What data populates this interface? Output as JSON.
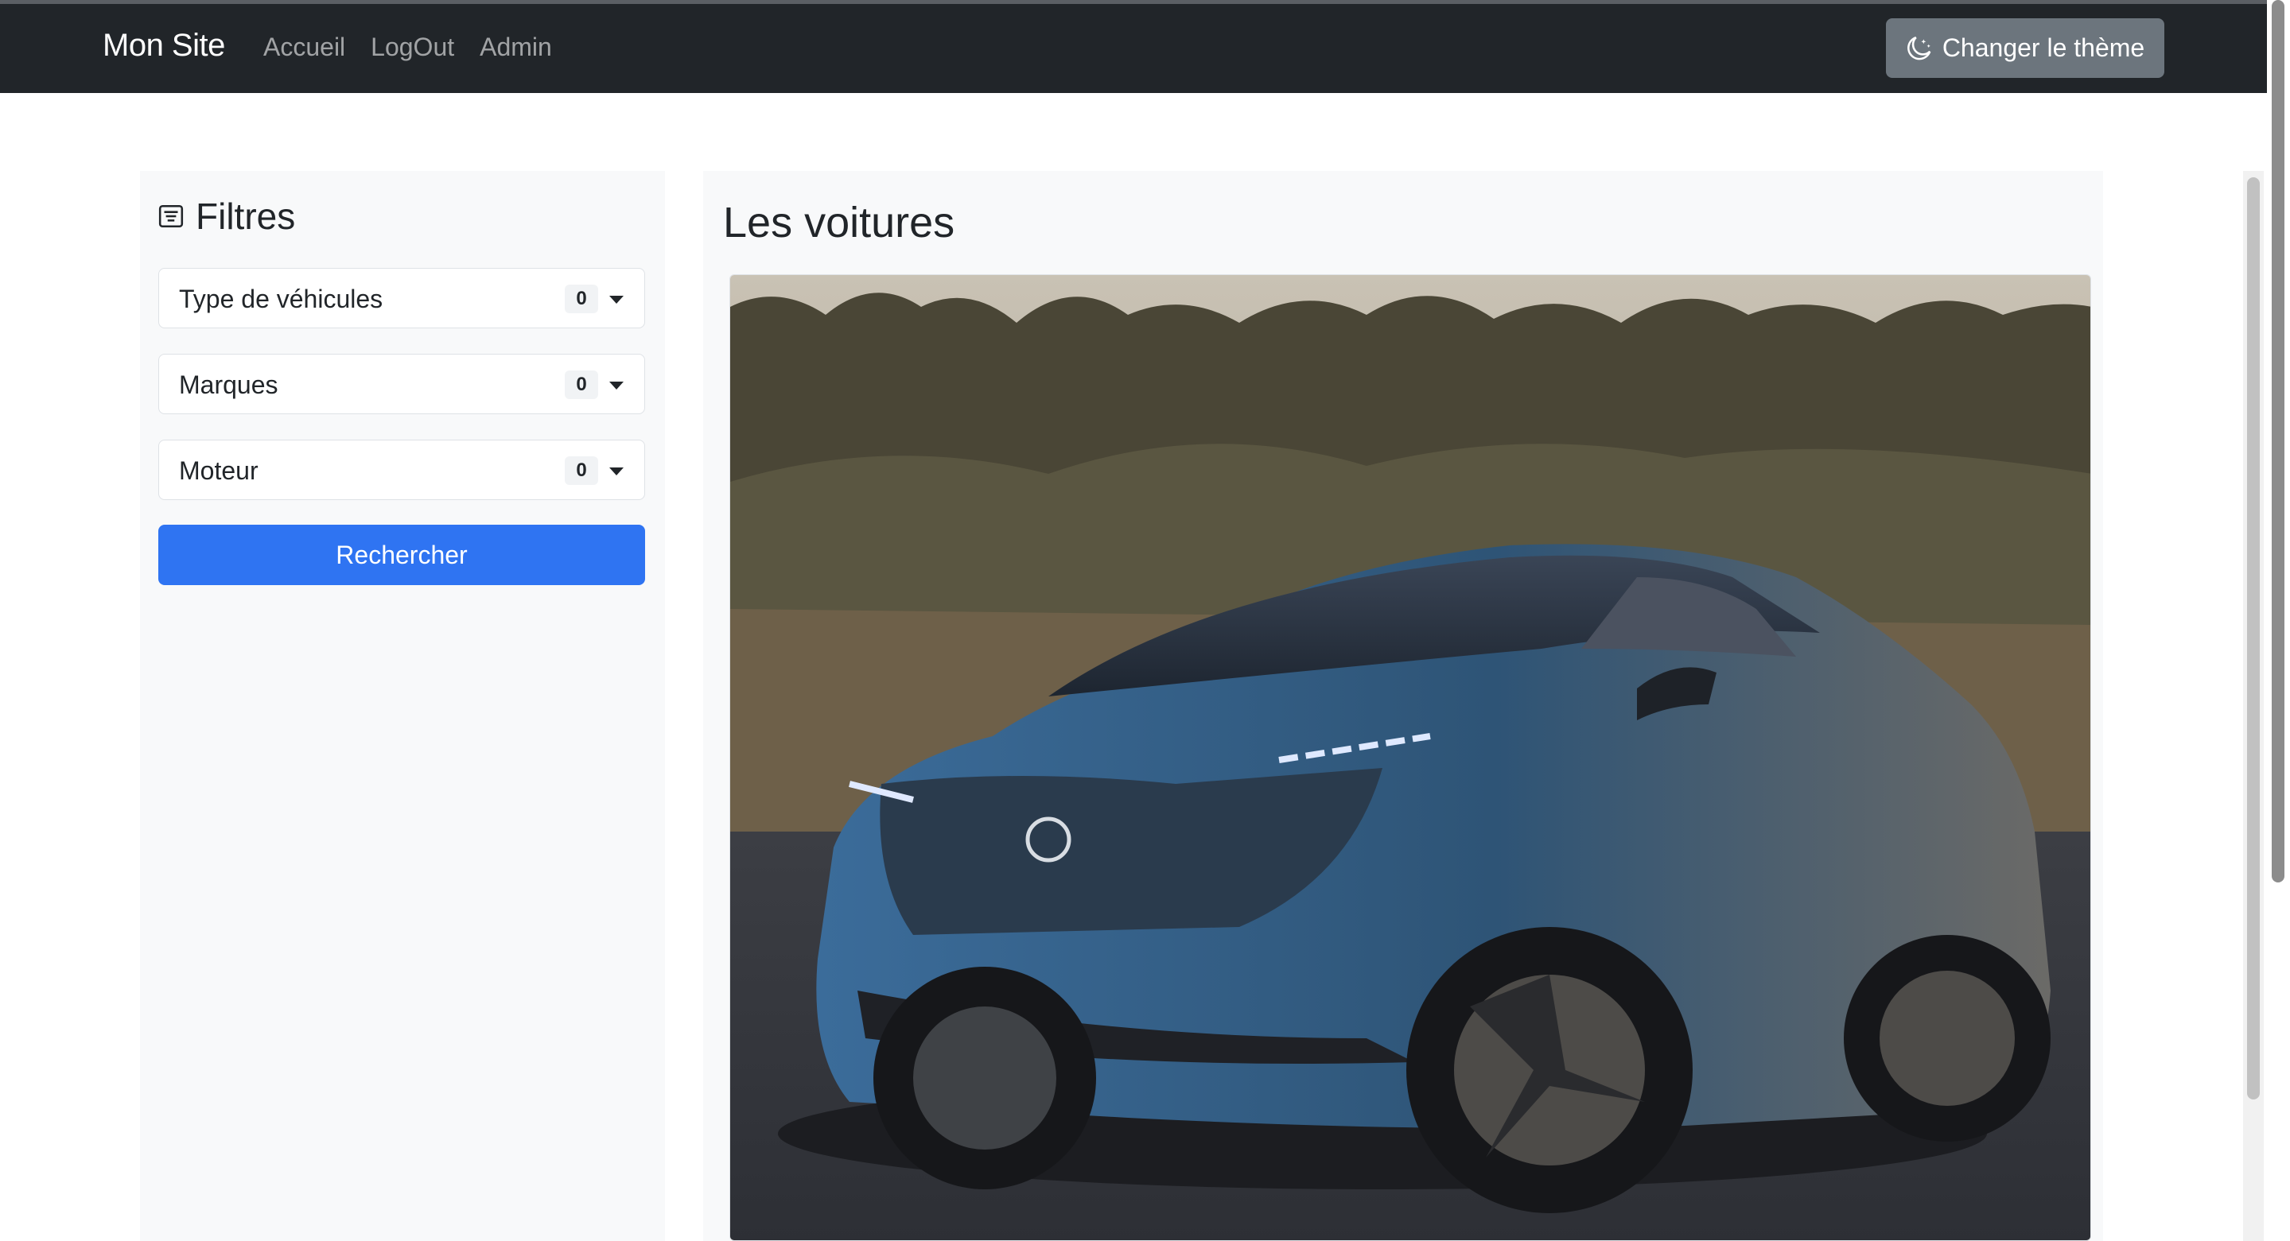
{
  "navbar": {
    "brand": "Mon Site",
    "links": [
      "Accueil",
      "LogOut",
      "Admin"
    ],
    "theme_button": "Changer le thème"
  },
  "filters": {
    "title": "Filtres",
    "selects": [
      {
        "label": "Type de véhicules",
        "count": "0"
      },
      {
        "label": "Marques",
        "count": "0"
      },
      {
        "label": "Moteur",
        "count": "0"
      }
    ],
    "search_button": "Rechercher"
  },
  "cars": {
    "title": "Les voitures"
  },
  "icons": {
    "theme": "moon-stars-icon",
    "filters": "filter-list-icon",
    "select_caret": "caret-down-icon"
  },
  "colors": {
    "navbar": "#212529",
    "primary": "#2f74f2",
    "secondary": "#6c757d",
    "panel": "#f8f9fa"
  }
}
